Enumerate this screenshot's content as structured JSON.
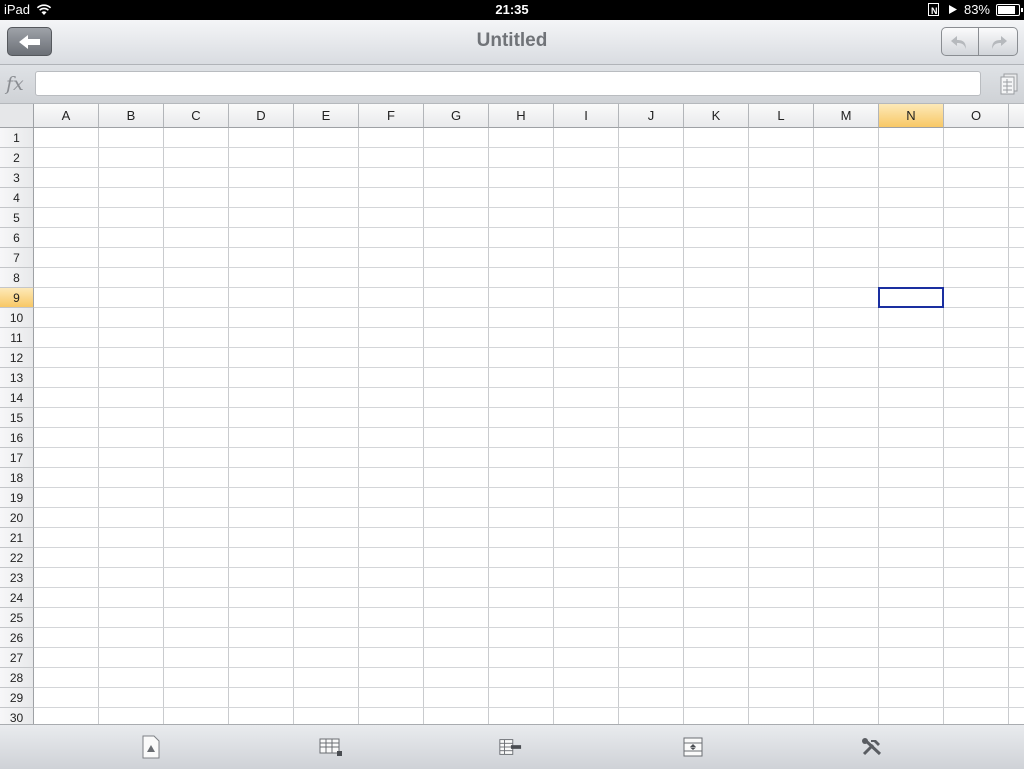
{
  "status_bar": {
    "device": "iPad",
    "time": "21:35",
    "battery": "83%",
    "battery_level": 0.83
  },
  "header": {
    "title": "Untitled"
  },
  "formula_bar": {
    "fx_label": "fx",
    "value": ""
  },
  "grid": {
    "columns": [
      "A",
      "B",
      "C",
      "D",
      "E",
      "F",
      "G",
      "H",
      "I",
      "J",
      "K",
      "L",
      "M",
      "N",
      "O"
    ],
    "rows": [
      "1",
      "2",
      "3",
      "4",
      "5",
      "6",
      "7",
      "8",
      "9",
      "10",
      "11",
      "12",
      "13",
      "14",
      "15",
      "16",
      "17",
      "18",
      "19",
      "20",
      "21",
      "22",
      "23",
      "24",
      "25",
      "26",
      "27",
      "28",
      "29",
      "30"
    ],
    "selected_column": "N",
    "selected_row": "9"
  },
  "toolbar": {
    "items": [
      "document-icon",
      "table-icon",
      "insert-row-icon",
      "row-height-icon",
      "tools-icon"
    ]
  }
}
